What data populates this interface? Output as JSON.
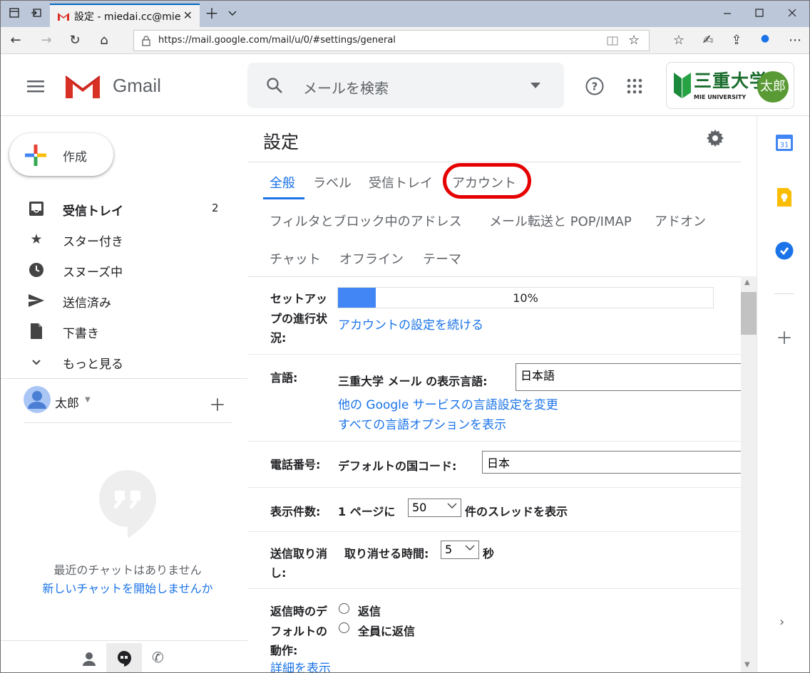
{
  "browser": {
    "tab_title": "設定 - miedai.cc@mie-u",
    "url": "https://mail.google.com/mail/u/0/#settings/general"
  },
  "header": {
    "logo_text": "Gmail",
    "search_placeholder": "メールを検索",
    "org_name": "三重大学",
    "org_sub": "MIE UNIVERSITY",
    "avatar_initials": "太郎"
  },
  "sidebar": {
    "compose_label": "作成",
    "items": [
      {
        "label": "受信トレイ",
        "count": "2",
        "icon": "inbox-icon"
      },
      {
        "label": "スター付き",
        "count": "",
        "icon": "star-icon"
      },
      {
        "label": "スヌーズ中",
        "count": "",
        "icon": "clock-icon"
      },
      {
        "label": "送信済み",
        "count": "",
        "icon": "send-icon"
      },
      {
        "label": "下書き",
        "count": "",
        "icon": "draft-icon"
      },
      {
        "label": "もっと見る",
        "count": "",
        "icon": "chevron-down-icon"
      }
    ],
    "user_name": "太郎",
    "no_chats_text": "最近のチャットはありません",
    "start_chat_link": "新しいチャットを開始しませんか"
  },
  "settings": {
    "title": "設定",
    "tabs_row1": [
      "全般",
      "ラベル",
      "受信トレイ",
      "アカウント"
    ],
    "tabs_row2": [
      "フィルタとブロック中のアドレス",
      "メール転送と POP/IMAP",
      "アドオン"
    ],
    "tabs_row3": [
      "チャット",
      "オフライン",
      "テーマ"
    ],
    "setup": {
      "label_l1": "セットアッ",
      "label_l2": "プの進行状",
      "label_l3": "況:",
      "progress_pct": 10,
      "progress_text": "10%",
      "continue_link": "アカウントの設定を続ける"
    },
    "language": {
      "label": "言語:",
      "display_label": "三重大学 メール の表示言語:",
      "value": "日本語",
      "link1": "他の Google サービスの言語設定を変更",
      "link2": "すべての言語オプションを表示"
    },
    "phone": {
      "label": "電話番号:",
      "country_label": "デフォルトの国コード:",
      "value": "日本"
    },
    "page_size": {
      "label": "表示件数:",
      "prefix": "1 ページに",
      "value": "50",
      "suffix": "件のスレッドを表示"
    },
    "undo_send": {
      "label_l1": "送信取り消",
      "label_l2": "し:",
      "time_label": "取り消せる時間:",
      "value": "5",
      "unit": "秒"
    },
    "reply_default": {
      "label_l1": "返信時のデ",
      "label_l2": "フォルトの",
      "label_l3": "動作:",
      "option1": "返信",
      "option2": "全員に返信",
      "details_link": "詳細を表示"
    }
  },
  "colors": {
    "accent_blue": "#1a73e8",
    "progress_blue": "#4285f4",
    "highlight_red": "#e60000",
    "avatar_green": "#5a9a35"
  }
}
